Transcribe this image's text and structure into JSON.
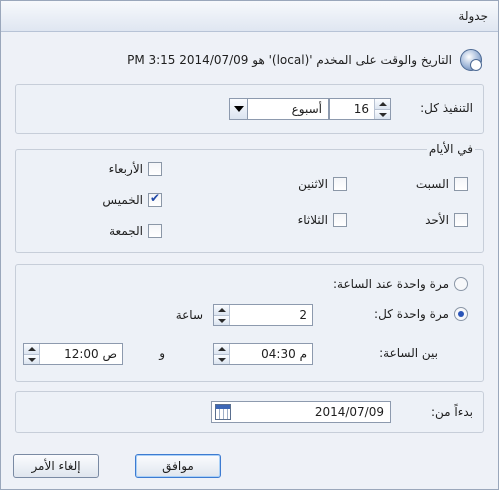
{
  "window": {
    "title": "جدولة"
  },
  "info": {
    "text": "التاريخ والوقت على المخدم '(local)' هو 2014/07/09 PM 3:15",
    "icon": "database-clock-icon"
  },
  "run_every": {
    "label": "التنفيذ كل:",
    "value": "16",
    "unit": "أسبوع"
  },
  "days": {
    "label": "في الأيام",
    "items": [
      {
        "label": "السبت",
        "checked": false
      },
      {
        "label": "الاثنين",
        "checked": false
      },
      {
        "label": "الأربعاء",
        "checked": false
      },
      {
        "label": "الخميس",
        "checked": true
      },
      {
        "label": "الأحد",
        "checked": false
      },
      {
        "label": "الثلاثاء",
        "checked": false
      },
      {
        "label": "الجمعة",
        "checked": false
      }
    ]
  },
  "frequency": {
    "once_at_label": "مرة واحدة عند الساعة:",
    "once_every_label": "مرة واحدة كل:",
    "every_value": "2",
    "every_unit": "ساعة",
    "between_label": "بين الساعة:",
    "start_time": "04:30 م",
    "and_label": "و",
    "end_time": "12:00 ص",
    "selected": "once_every"
  },
  "start": {
    "label": "بدءاً من:",
    "date": "2014/07/09"
  },
  "buttons": {
    "ok": "موافق",
    "cancel": "إلغاء الأمر"
  }
}
